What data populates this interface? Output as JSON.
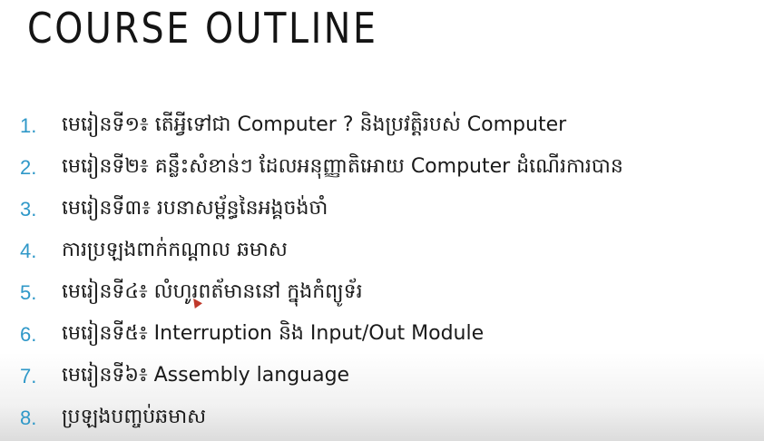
{
  "slide": {
    "title": "COURSE OUTLINE",
    "items": [
      {
        "number": "1.",
        "text": "មេរៀនទី១៖ តើអ្វីទៅជា Computer ? និងប្រវត្តិរបស់ Computer"
      },
      {
        "number": "2.",
        "text": "មេរៀនទី២៖ គន្លឹះសំខាន់ៗ ដែលអនុញ្ញាតិអោយ Computer ដំណើរការបាន"
      },
      {
        "number": "3.",
        "text": "មេរៀនទី៣៖ របនាសម្ព័ន្ធនៃអង្គចង់ចាំ"
      },
      {
        "number": "4.",
        "text": "ការប្រឡងពាក់កណ្តាល ឆមាស"
      },
      {
        "number": "5.",
        "text": "មេរៀនទី៤៖ លំហូរពត័មាននៅ ក្នុងកំព្យូទ័រ"
      },
      {
        "number": "6.",
        "text": "មេរៀនទី៥៖ Interruption និង Input/Out Module"
      },
      {
        "number": "7.",
        "text": "មេរៀនទី៦៖ Assembly language"
      },
      {
        "number": "8.",
        "text": "ប្រឡងបញ្ចប់ឆមាស"
      }
    ]
  },
  "colors": {
    "number": "#2f98c8",
    "text": "#1a1a1a",
    "title": "#141414",
    "cursor": "#c0392b"
  },
  "icons": {
    "cursor": "mouse-cursor-icon"
  }
}
